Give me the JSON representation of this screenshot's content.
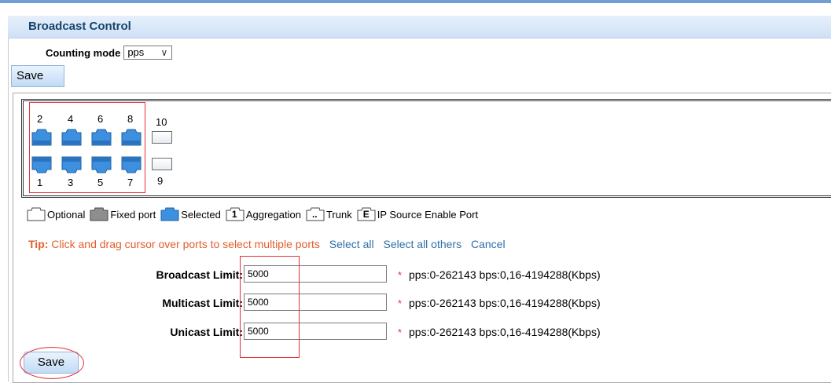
{
  "header": {
    "title": "Broadcast Control"
  },
  "counting": {
    "label": "Counting mode",
    "value": "pps"
  },
  "toolbar": {
    "save_label": "Save"
  },
  "ports": {
    "top": [
      {
        "num": "2",
        "state": "selected"
      },
      {
        "num": "4",
        "state": "selected"
      },
      {
        "num": "6",
        "state": "selected"
      },
      {
        "num": "8",
        "state": "selected"
      },
      {
        "num": "10",
        "state": "optional"
      }
    ],
    "bottom": [
      {
        "num": "1",
        "state": "selected"
      },
      {
        "num": "3",
        "state": "selected"
      },
      {
        "num": "5",
        "state": "selected"
      },
      {
        "num": "7",
        "state": "selected"
      },
      {
        "num": "9",
        "state": "optional"
      }
    ]
  },
  "legend": {
    "optional": "Optional",
    "fixed": "Fixed port",
    "selected": "Selected",
    "aggregation": "Aggregation",
    "aggregation_icon": "1",
    "trunk": "Trunk",
    "trunk_icon": "..",
    "ipsource": "IP Source Enable Port",
    "ipsource_icon": "E"
  },
  "tip": {
    "label": "Tip:",
    "text": "Click and drag cursor over ports to select multiple ports",
    "select_all": "Select all",
    "select_others": "Select all others",
    "cancel": "Cancel"
  },
  "form": {
    "broadcast": {
      "label": "Broadcast Limit:",
      "value": "5000",
      "hint": "pps:0-262143 bps:0,16-4194288(Kbps)"
    },
    "multicast": {
      "label": "Multicast Limit:",
      "value": "5000",
      "hint": "pps:0-262143 bps:0,16-4194288(Kbps)"
    },
    "unicast": {
      "label": "Unicast Limit:",
      "value": "5000",
      "hint": "pps:0-262143 bps:0,16-4194288(Kbps)"
    },
    "required_mark": "*"
  },
  "footer": {
    "save_label": "Save"
  },
  "colors": {
    "accent": "#17456b",
    "selected_port": "#3d8fe0",
    "tip": "#e35d2b",
    "highlight": "#e4323a"
  }
}
